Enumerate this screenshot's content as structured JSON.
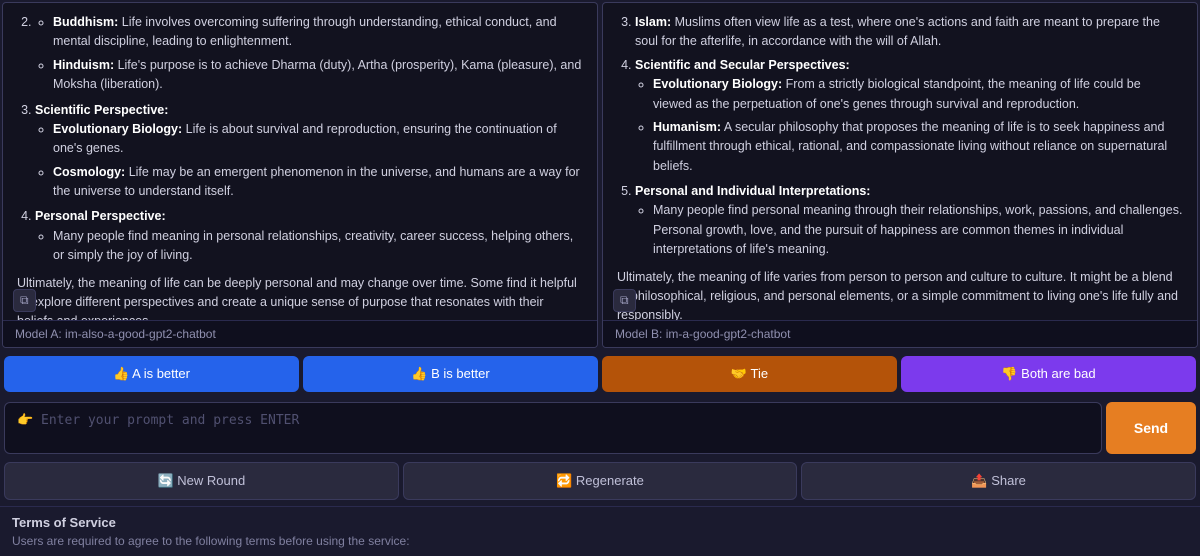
{
  "panels": {
    "left": {
      "model_label": "Model A: im-also-a-good-gpt2-chatbot",
      "content": [
        {
          "type": "section",
          "header": "Buddhism:",
          "text": " Life involves overcoming suffering through understanding, ethical conduct, and mental discipline, leading to enlightenment."
        },
        {
          "type": "section",
          "header": "Hinduism:",
          "text": " Life's purpose is to achieve Dharma (duty), Artha (prosperity), Kama (pleasure), and Moksha (liberation)."
        },
        {
          "type": "heading",
          "text": "Scientific Perspective:"
        },
        {
          "type": "section",
          "header": "Evolutionary Biology:",
          "text": " Life is about survival and reproduction, ensuring the continuation of one's genes."
        },
        {
          "type": "section",
          "header": "Cosmology:",
          "text": " Life may be an emergent phenomenon in the universe, and humans are a way for the universe to understand itself."
        },
        {
          "type": "heading",
          "text": "Personal Perspective:"
        },
        {
          "type": "text",
          "text": "Many people find meaning in personal relationships, creativity, career success, helping others, or simply the joy of living."
        },
        {
          "type": "paragraph",
          "text": "Ultimately, the meaning of life can be deeply personal and may change over time. Some find it helpful to explore different perspectives and create a unique sense of purpose that resonates with their beliefs and experiences."
        }
      ]
    },
    "right": {
      "model_label": "Model B: im-a-good-gpt2-chatbot",
      "content": [
        {
          "type": "section",
          "header": "Islam:",
          "text": " Muslims often view life as a test, where one's actions and faith are meant to prepare the soul for the afterlife, in accordance with the will of Allah."
        },
        {
          "type": "heading",
          "text": "Scientific and Secular Perspectives:"
        },
        {
          "type": "section",
          "header": "Evolutionary Biology:",
          "text": " From a strictly biological standpoint, the meaning of life could be viewed as the perpetuation of one's genes through survival and reproduction."
        },
        {
          "type": "section",
          "header": "Humanism:",
          "text": " A secular philosophy that proposes the meaning of life is to seek happiness and fulfillment through ethical, rational, and compassionate living without reliance on supernatural beliefs."
        },
        {
          "type": "heading",
          "text": "Personal and Individual Interpretations:"
        },
        {
          "type": "text",
          "text": "Many people find personal meaning through their relationships, work, passions, and challenges. Personal growth, love, and the pursuit of happiness are common themes in individual interpretations of life's meaning."
        },
        {
          "type": "paragraph",
          "text": "Ultimately, the meaning of life varies from person to person and culture to culture. It might be a blend of philosophical, religious, and personal elements, or a simple commitment to living one's life fully and responsibly."
        }
      ]
    }
  },
  "voting": {
    "a_better": "👍 A is better",
    "b_better": "👍 B is better",
    "tie": "🤝 Tie",
    "both_bad": "👎 Both are bad"
  },
  "input": {
    "placeholder": "👉 Enter your prompt and press ENTER",
    "send_label": "Send"
  },
  "actions": {
    "new_round": "🔄 New Round",
    "regenerate": "🔁 Regenerate",
    "share": "📤 Share"
  },
  "terms": {
    "title": "Terms of Service",
    "text": "Users are required to agree to the following terms before using the service:"
  }
}
